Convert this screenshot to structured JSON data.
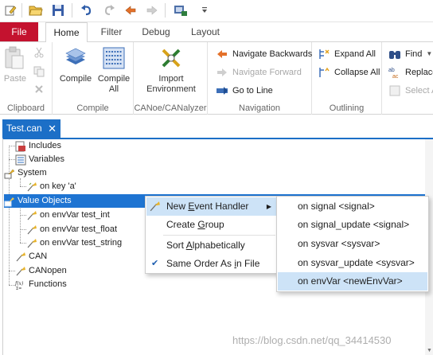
{
  "quick_access": {
    "icons": [
      "edit-icon",
      "open-folder-icon",
      "save-icon",
      "undo-icon",
      "redo-icon",
      "back-icon",
      "forward-icon",
      "compile-quick-icon",
      "customize-dropdown-icon"
    ]
  },
  "tabs": [
    {
      "label": "File"
    },
    {
      "label": "Home"
    },
    {
      "label": "Filter"
    },
    {
      "label": "Debug"
    },
    {
      "label": "Layout"
    }
  ],
  "ribbon": {
    "clipboard": {
      "label": "Clipboard",
      "paste": "Paste"
    },
    "compile": {
      "label": "Compile",
      "compile": "Compile",
      "compile_all_line1": "Compile",
      "compile_all_line2": "All"
    },
    "canoe": {
      "label": "CANoe/CANalyzer",
      "import_line1": "Import",
      "import_line2": "Environment"
    },
    "navigation": {
      "label": "Navigation",
      "back": "Navigate Backwards",
      "forward": "Navigate Forward",
      "goto": "Go to Line"
    },
    "outlining": {
      "label": "Outlining",
      "expand": "Expand All",
      "collapse": "Collapse All"
    },
    "editing": {
      "find": "Find",
      "replace": "Replace",
      "select": "Select A"
    }
  },
  "document_tab": {
    "title": "Test.can",
    "close": "✕"
  },
  "tree": [
    {
      "label": "Includes"
    },
    {
      "label": "Variables"
    },
    {
      "label": "System"
    },
    {
      "label": "on key 'a'"
    },
    {
      "label": "Value Objects"
    },
    {
      "label": "on envVar test_int"
    },
    {
      "label": "on envVar test_float"
    },
    {
      "label": "on envVar test_string"
    },
    {
      "label": "CAN"
    },
    {
      "label": "CANopen"
    },
    {
      "label": "Functions"
    }
  ],
  "context_menu": {
    "new_event_handler": {
      "pre": "New ",
      "accel": "E",
      "post": "vent Handler"
    },
    "create_group": {
      "pre": "Create ",
      "accel": "G",
      "post": "roup"
    },
    "sort_alpha": {
      "pre": "Sort ",
      "accel": "A",
      "post": "lphabetically"
    },
    "same_order": {
      "pre": "Same Order As ",
      "accel": "i",
      "post": "n File"
    },
    "submenu_arrow": "▶",
    "check": "✔"
  },
  "submenu": [
    {
      "label": "on signal <signal>"
    },
    {
      "label": "on signal_update <signal>"
    },
    {
      "label": "on sysvar <sysvar>"
    },
    {
      "label": "on sysvar_update <sysvar>"
    },
    {
      "label": "on envVar <newEnvVar>"
    }
  ],
  "watermark": "https://blog.csdn.net/qq_34414530",
  "colors": {
    "file_tab": "#c4122f",
    "selection": "#1e74d2",
    "menu_highlight": "#cde3f7",
    "doc_tab": "#1c6fc7"
  }
}
